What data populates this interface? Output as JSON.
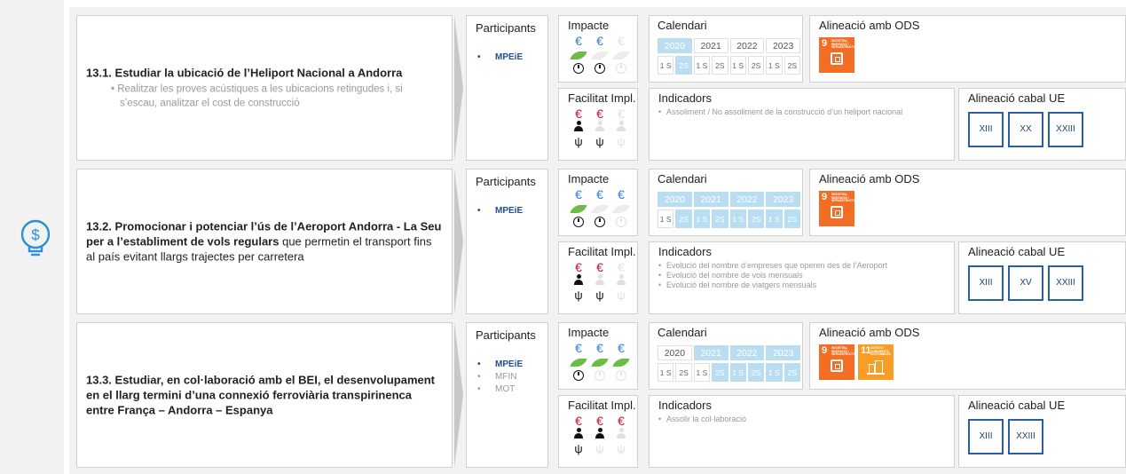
{
  "rows": [
    {
      "title_bold": "13.1. Estudiar la ubicació de l’Heliport Nacional a Andorra",
      "title_rest": "",
      "subtext": "Realitzar les proves acústiques a les ubicacions retingudes i, si s’escau, analitzar el cost de construcció",
      "participants_label": "Participants",
      "participants": [
        "MPEiE"
      ],
      "impacte_label": "Impacte",
      "impacte": {
        "euro": [
          true,
          true,
          false
        ],
        "leaf": [
          true,
          false,
          false
        ],
        "clock": [
          true,
          true,
          false
        ]
      },
      "facilitat_label": "Facilitat Impl.",
      "facilitat": {
        "euro": [
          true,
          true,
          false
        ],
        "person": [
          true,
          false,
          false
        ],
        "tool": [
          true,
          true,
          false
        ]
      },
      "calendari_label": "Calendari",
      "years": [
        "2020",
        "2021",
        "2022",
        "2023"
      ],
      "years_on": [
        true,
        false,
        false,
        false
      ],
      "semesters": [
        "1 S",
        "2S",
        "1 S",
        "2S",
        "1 S",
        "2S",
        "1 S",
        "2S"
      ],
      "semesters_on": [
        false,
        true,
        false,
        false,
        false,
        false,
        false,
        false
      ],
      "ods_label": "Alineació amb ODS",
      "ods": [
        {
          "num": "9",
          "text": "INDÚSTRIA, INNOVACIÓ I INFRAESTRUCTURA",
          "color": "#f36d25",
          "icon": "cube"
        }
      ],
      "indicadors_label": "Indicadors",
      "indicadors": [
        "Assoliment / No assoliment de la construcció d’un heliport nacional"
      ],
      "eu_label": "Alineació cabal UE",
      "eu": [
        "XIII",
        "XX",
        "XXIII"
      ]
    },
    {
      "title_bold": "13.2. Promocionar i potenciar l’ús de l’Aeroport Andorra - La Seu per a l’establiment de vols regulars",
      "title_rest": " que permetin el transport fins al país evitant llargs trajectes per carretera",
      "subtext": "",
      "participants_label": "Participants",
      "participants": [
        "MPEiE"
      ],
      "impacte_label": "Impacte",
      "impacte": {
        "euro": [
          true,
          true,
          true
        ],
        "leaf": [
          true,
          false,
          false
        ],
        "clock": [
          true,
          true,
          false
        ]
      },
      "facilitat_label": "Facilitat Impl.",
      "facilitat": {
        "euro": [
          true,
          true,
          false
        ],
        "person": [
          true,
          false,
          false
        ],
        "tool": [
          true,
          true,
          false
        ]
      },
      "calendari_label": "Calendari",
      "years": [
        "2020",
        "2021",
        "2022",
        "2023"
      ],
      "years_on": [
        true,
        true,
        true,
        true
      ],
      "semesters": [
        "1 S",
        "2S",
        "1 S",
        "2S",
        "1 S",
        "2S",
        "1 S",
        "2S"
      ],
      "semesters_on": [
        false,
        true,
        true,
        true,
        true,
        true,
        true,
        true
      ],
      "ods_label": "Alineació amb ODS",
      "ods": [
        {
          "num": "9",
          "text": "INDÚSTRIA, INNOVACIÓ I INFRAESTRUCTURA",
          "color": "#f36d25",
          "icon": "cube"
        }
      ],
      "indicadors_label": "Indicadors",
      "indicadors": [
        "Evolució del nombre d’empreses que operen des de l’Aeroport",
        "Evolució del nombre de vols mensuals",
        "Evolució del nombre de viatgers mensuals"
      ],
      "eu_label": "Alineació cabal UE",
      "eu": [
        "XIII",
        "XV",
        "XXIII"
      ]
    },
    {
      "title_bold": "13.3. Estudiar, en col·laboració amb el BEI,  el desenvolupament en el llarg termini d’una connexió ferroviària transpirinenca entre França – Andorra – Espanya",
      "title_rest": "",
      "subtext": "",
      "participants_label": "Participants",
      "participants": [
        "MPEiE",
        "MFIN",
        "MOT"
      ],
      "impacte_label": "Impacte",
      "impacte": {
        "euro": [
          true,
          true,
          true
        ],
        "leaf": [
          true,
          true,
          true
        ],
        "clock": [
          true,
          false,
          false
        ]
      },
      "facilitat_label": "Facilitat Impl.",
      "facilitat": {
        "euro": [
          true,
          true,
          true
        ],
        "person": [
          true,
          true,
          false
        ],
        "tool": [
          true,
          false,
          false
        ]
      },
      "calendari_label": "Calendari",
      "years": [
        "2020",
        "2021",
        "2022",
        "2023"
      ],
      "years_on": [
        false,
        true,
        true,
        true
      ],
      "semesters": [
        "1 S",
        "2S",
        "1 S",
        "2S",
        "1 S",
        "2S",
        "1 S",
        "2S"
      ],
      "semesters_on": [
        false,
        false,
        false,
        true,
        true,
        true,
        true,
        true
      ],
      "ods_label": "Alineació amb ODS",
      "ods": [
        {
          "num": "9",
          "text": "INDÚSTRIA, INNOVACIÓ I INFRAESTRUCTURA",
          "color": "#f36d25",
          "icon": "cube"
        },
        {
          "num": "11",
          "text": "CIUTATS I COMUNITATS SOSTENIBLES",
          "color": "#f99d26",
          "icon": "city"
        }
      ],
      "indicadors_label": "Indicadors",
      "indicadors": [
        "Assolir la col·laboració"
      ],
      "eu_label": "Alineació cabal UE",
      "eu": [
        "XIII",
        "XXIII"
      ]
    }
  ],
  "icons": {
    "left": "lightbulb-dollar-icon",
    "euro": "€",
    "tool": "ψ"
  },
  "colors": {
    "euro_impacte": "#2f7fd6",
    "euro_facilitat": "#c0152d",
    "leaf": "#6cbd45",
    "calendar_on": "#b9def2",
    "eu_border": "#2a5fa8",
    "participant_main": "#1f4e9a"
  }
}
